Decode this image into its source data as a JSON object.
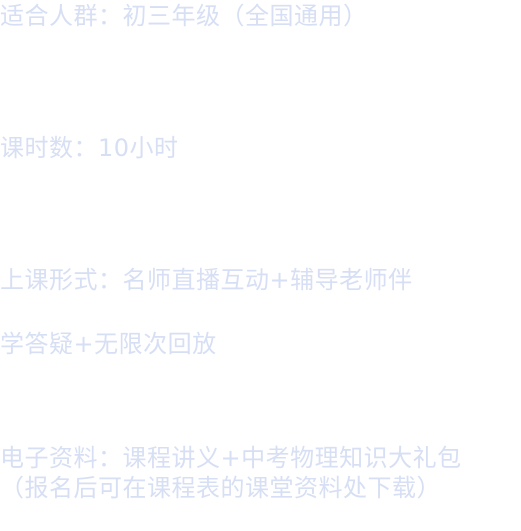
{
  "info": {
    "audience": "适合人群：初三年级（全国通用）",
    "hours": "课时数：10小时",
    "format_line1": "上课形式：名师直播互动+辅导老师伴",
    "format_line2": "学答疑+无限次回放",
    "materials_line1": "电子资料：课程讲义+中考物理知识大礼包",
    "materials_line2": "（报名后可在课程表的课堂资料处下载）"
  },
  "colors": {
    "text": "#d7dff4",
    "background": "#ffffff"
  }
}
